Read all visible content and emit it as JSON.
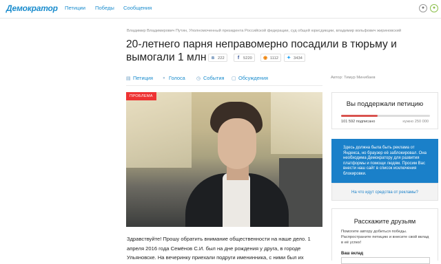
{
  "nav": {
    "logo": "Демократор",
    "links": [
      "Петиции",
      "Победы",
      "Сообщения"
    ],
    "icons": [
      "user-icon",
      "odnoklassniki-icon"
    ]
  },
  "breadcrumb": "Владимир Владимирович Путин, Уполномоченный президента Российской федерации, суд общей юрисдикции, владимир вольфович жириновский",
  "petition": {
    "title": "20-летнего парня неправомерно посадили в тюрьму и вымогали 1 млн",
    "shares": {
      "vk": "222",
      "fb": "5220",
      "ok": "1112",
      "tw": "3434"
    },
    "tabs": [
      "Петиция",
      "Голоса",
      "События",
      "Обсуждения"
    ],
    "author": "Автор: Тимур Минибаев",
    "badge": "ПРОБЛЕМА",
    "body": "Здравствуйте! Прошу обратить внимание общественности на наше дело. 1 апреля 2016 года Семёнов С.И. был на дне рождения у друга, в городе Ульяновске. На вечеринку приехали подруги именинника, с ними был их"
  },
  "support": {
    "heading": "Вы поддержали петицию",
    "count": "101 592 подписано",
    "need": "нужно 250 000",
    "progress": 0.41,
    "accent": "#d9534f"
  },
  "ad": {
    "text": "Здесь должна была быть реклама от Яндекса, но браузер её заблокировал. Она необходима Демократору для развития платформы и помощи людям. Просим Вас внести наш сайт в список исключения блокировки.",
    "link": "На что идут средства от рекламы?",
    "color": "#1a80c9"
  },
  "friends": {
    "heading": "Расскажите друзьям",
    "text": "Помогите автору добиться победы. Распространите петицию и внесите свой вклад в её успех!",
    "label": "Ваш вклад"
  }
}
